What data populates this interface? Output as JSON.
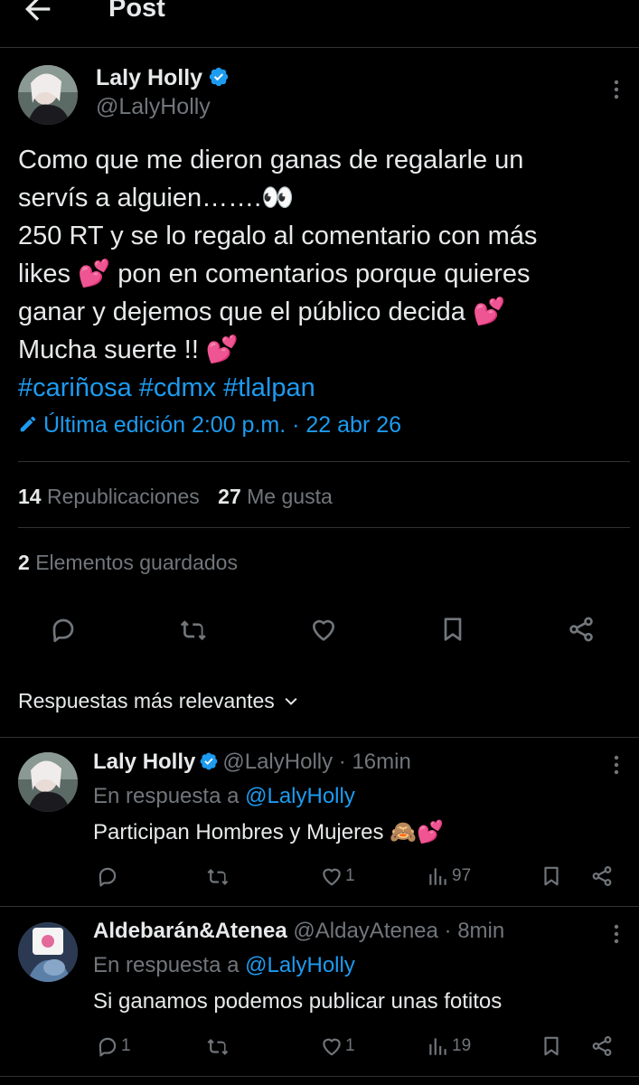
{
  "header": {
    "title": "Post"
  },
  "post": {
    "author_name": "Laly Holly",
    "author_handle": "@LalyHolly",
    "text_lines": [
      "Como que me dieron ganas de regalarle un",
      "servís a alguien…….👀",
      "250 RT y se lo regalo al comentario con más",
      "likes 💕 pon en comentarios porque quieres",
      "ganar y dejemos que el público decida 💕",
      "Mucha suerte !! 💕"
    ],
    "hashtags": [
      "#cariñosa",
      "#cdmx",
      "#tlalpan"
    ],
    "edited": "Última edición 2:00 p.m. · 22 abr 26",
    "reposts_count": "14",
    "reposts_label": "Republicaciones",
    "likes_count": "27",
    "likes_label": "Me gusta",
    "bookmarks_count": "2",
    "bookmarks_label": "Elementos guardados"
  },
  "sort": {
    "label": "Respuestas más relevantes"
  },
  "replies": [
    {
      "name": "Laly Holly",
      "handle": "@LalyHolly · 16min",
      "in_reply_prefix": "En respuesta a ",
      "in_reply_handle": "@LalyHolly",
      "text": "Participan Hombres y Mujeres 🙈💕",
      "replies": "",
      "reposts": "",
      "likes": "1",
      "views": "97"
    },
    {
      "name": "Aldebarán&Atenea",
      "handle": "@AldayAtenea · 8min",
      "in_reply_prefix": "En respuesta a ",
      "in_reply_handle": "@LalyHolly",
      "text": "Si ganamos podemos publicar unas fotitos",
      "replies": "1",
      "reposts": "",
      "likes": "1",
      "views": "19"
    }
  ],
  "colors": {
    "accent": "#1d9bf0",
    "muted": "#71767b",
    "text": "#e7e9ea",
    "background": "#000000",
    "border": "#2f3336"
  }
}
